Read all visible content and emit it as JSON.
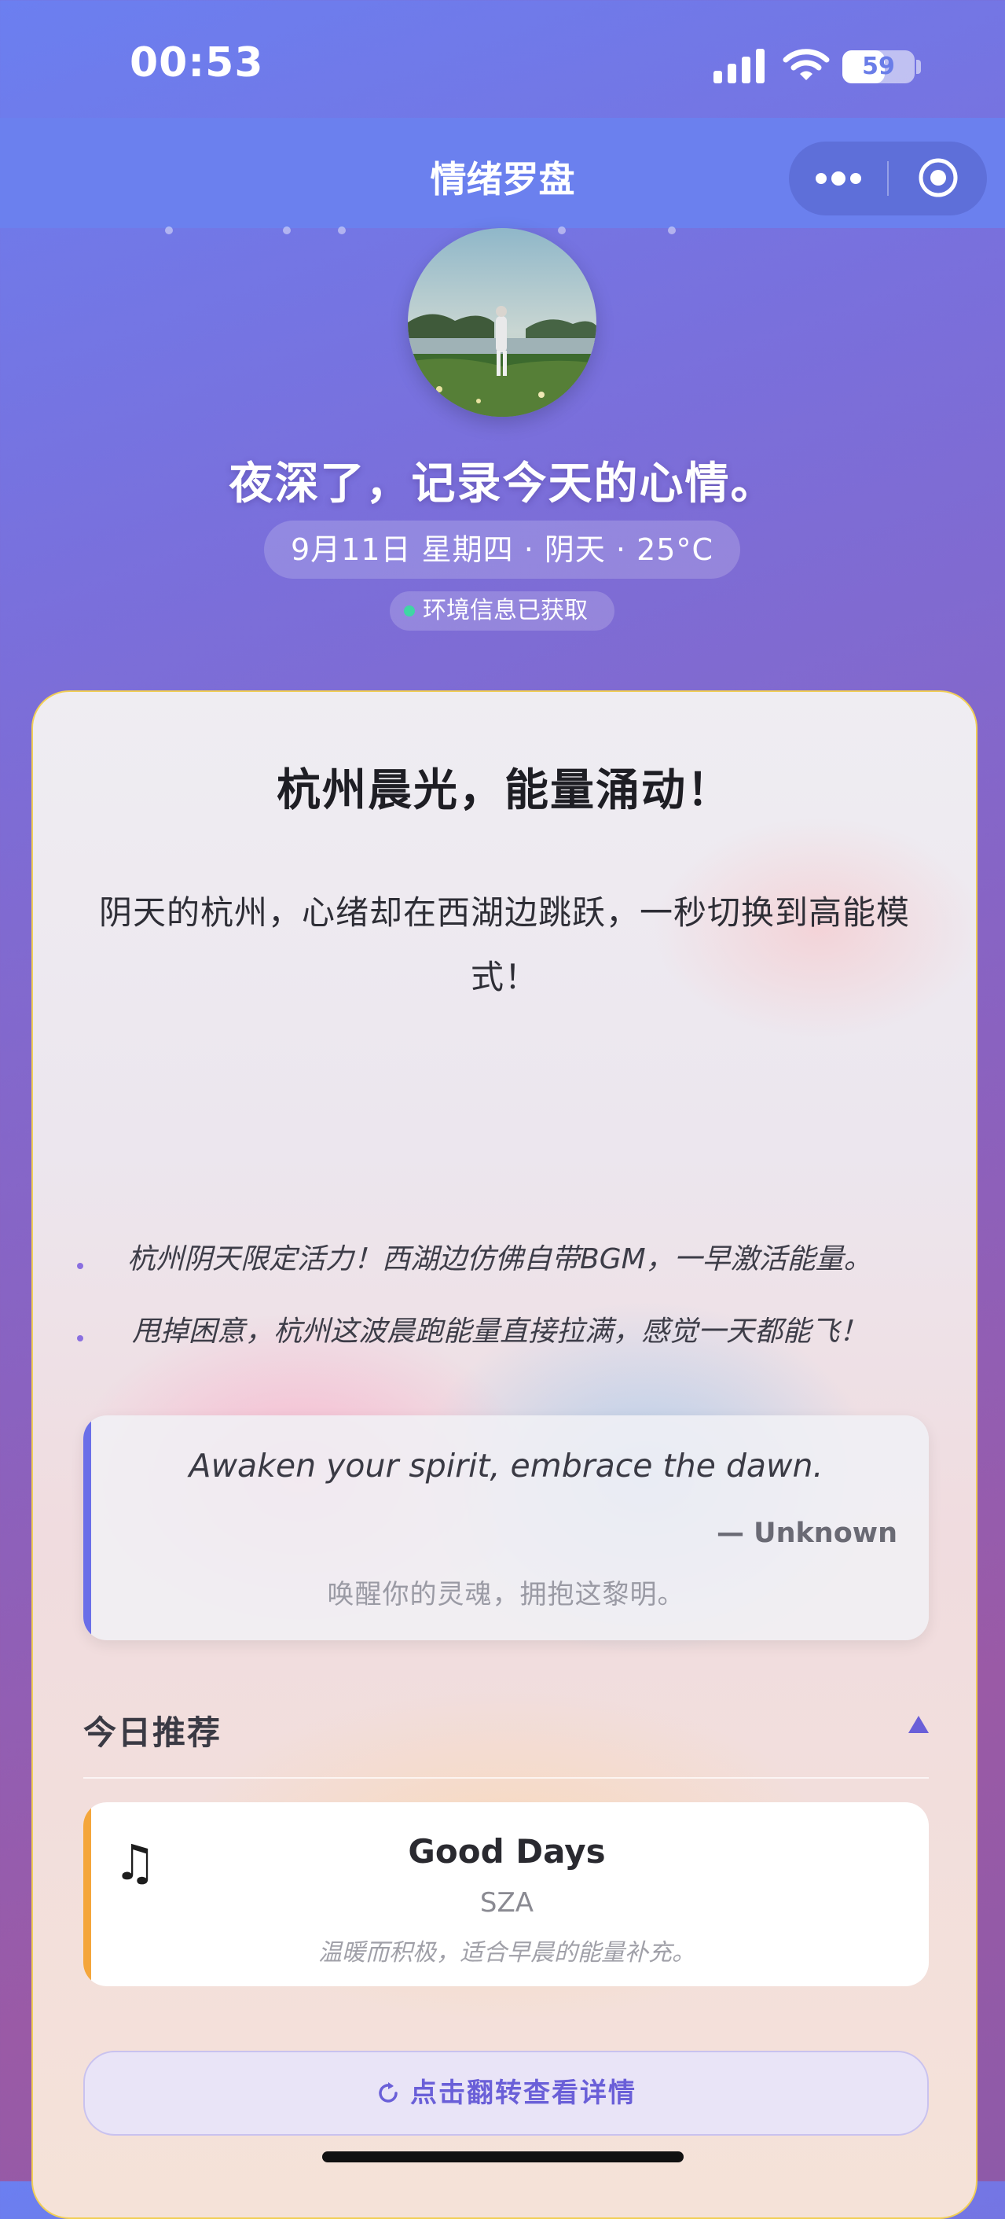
{
  "status_bar": {
    "time": "00:53",
    "battery": "59",
    "battery_level": 0.59
  },
  "nav": {
    "title": "情绪罗盘"
  },
  "header": {
    "greeting": "夜深了，记录今天的心情。",
    "date_weather": "9月11日 星期四 · 阴天 · 25°C",
    "env_status": "环境信息已获取"
  },
  "card": {
    "title": "杭州晨光，能量涌动！",
    "description": "阴天的杭州，心绪却在西湖边跳跃，一秒切换到高能模式！",
    "bullets": [
      "杭州阴天限定活力！西湖边仿佛自带BGM，一早激活能量。",
      "甩掉困意，杭州这波晨跑能量直接拉满，感觉一天都能飞！"
    ],
    "quote": {
      "text": "Awaken your spirit, embrace the dawn.",
      "author": "— Unknown",
      "translation": "唤醒你的灵魂，拥抱这黎明。"
    },
    "recommendation": {
      "section_title": "今日推荐",
      "song_title": "Good Days",
      "artist": "SZA",
      "note": "温暖而积极，适合早晨的能量补充。",
      "icon": "music-note-icon"
    },
    "flip_button": "点击翻转查看详情"
  },
  "colors": {
    "accent": "#6a5fd8",
    "card_border": "#f1cf56",
    "song_accent": "#f4a63b",
    "quote_accent": "#6a6ee8"
  }
}
